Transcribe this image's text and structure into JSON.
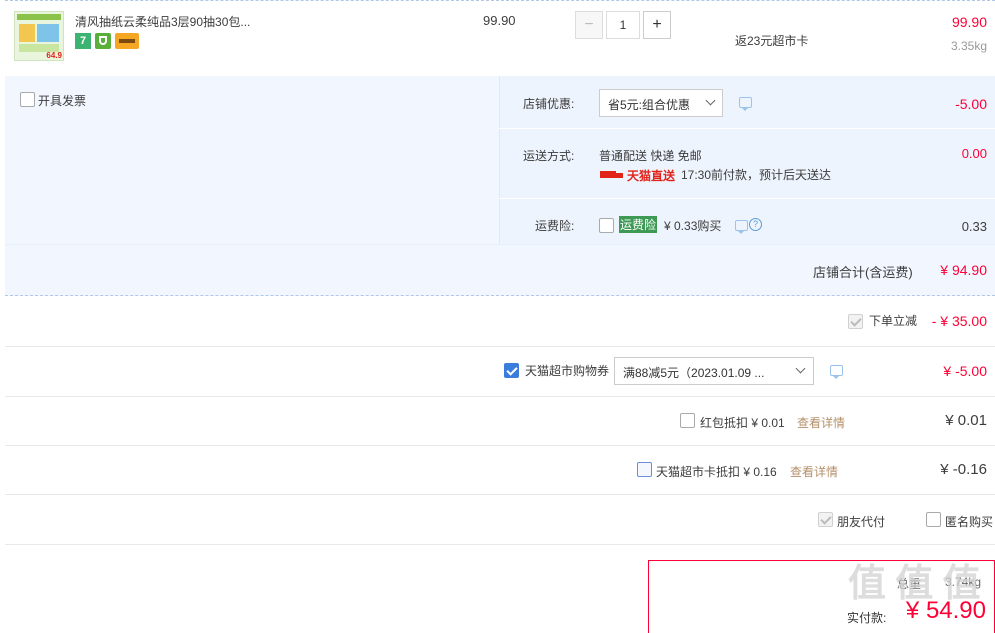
{
  "product": {
    "title": "清风抽纸云柔纯品3层90抽30包...",
    "thumb_badge": "64.9",
    "unit_price": "99.90",
    "quantity": "1",
    "minus": "−",
    "plus": "+",
    "rebate": "返23元超市卡",
    "subtotal": "99.90",
    "weight": "3.35kg",
    "tag_7": "7"
  },
  "shop": {
    "invoice_label": "开具发票",
    "discount_label": "店铺优惠:",
    "discount_select": "省5元:组合优惠",
    "discount_amount": "-5.00",
    "shipping_label": "运送方式:",
    "shipping_method": "普通配送 快递 免邮",
    "tmall_direct": "天猫直送",
    "delivery_note": "17:30前付款，预计后天送达",
    "shipping_amount": "0.00",
    "insurance_label": "运费险:",
    "insurance_tag": "运费险",
    "insurance_price": "¥ 0.33购买",
    "insurance_amount": "0.33",
    "total_label": "店铺合计(含运费)",
    "total_amount": "¥ 94.90"
  },
  "order": {
    "instant_discount_label": "下单立减",
    "instant_discount_amount": "- ¥ 35.00",
    "coupon_label": "天猫超市购物券",
    "coupon_select": "满88减5元（2023.01.09 ...",
    "coupon_amount": "¥ -5.00",
    "redpacket_label": "红包抵扣 ¥ 0.01",
    "redpacket_link": "查看详情",
    "redpacket_amount": "¥ 0.01",
    "card_label": "天猫超市卡抵扣 ¥ 0.16",
    "card_link": "查看详情",
    "card_amount": "¥ -0.16",
    "friend_pay": "朋友代付",
    "anonymous": "匿名购买"
  },
  "summary": {
    "weight_label": "总重",
    "weight_value": "3.74kg",
    "paid_label": "实付款:",
    "paid_amount": "¥ 54.90"
  },
  "watermark": "值 值 值"
}
